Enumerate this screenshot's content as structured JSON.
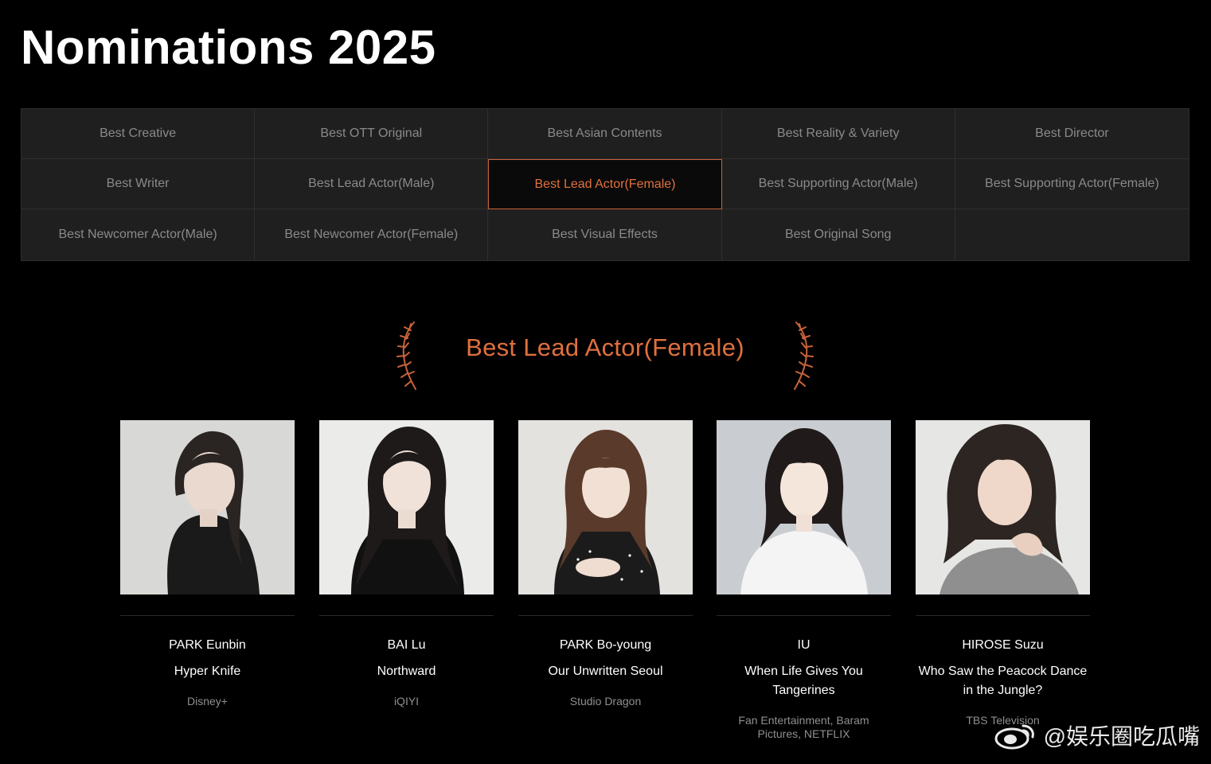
{
  "page": {
    "title": "Nominations 2025"
  },
  "categories": [
    {
      "label": "Best Creative"
    },
    {
      "label": "Best OTT Original"
    },
    {
      "label": "Best Asian Contents"
    },
    {
      "label": "Best Reality & Variety"
    },
    {
      "label": "Best Director"
    },
    {
      "label": "Best Writer"
    },
    {
      "label": "Best Lead Actor(Male)"
    },
    {
      "label": "Best Lead Actor(Female)"
    },
    {
      "label": "Best Supporting Actor(Male)"
    },
    {
      "label": "Best Supporting Actor(Female)"
    },
    {
      "label": "Best Newcomer Actor(Male)"
    },
    {
      "label": "Best Newcomer Actor(Female)"
    },
    {
      "label": "Best Visual Effects"
    },
    {
      "label": "Best Original Song"
    }
  ],
  "selected_category": "Best Lead Actor(Female)",
  "section": {
    "title": "Best Lead Actor(Female)"
  },
  "nominees": [
    {
      "name": "PARK Eunbin",
      "work": "Hyper Knife",
      "studio": "Disney+"
    },
    {
      "name": "BAI Lu",
      "work": "Northward",
      "studio": "iQIYI"
    },
    {
      "name": "PARK Bo-young",
      "work": "Our Unwritten Seoul",
      "studio": "Studio Dragon"
    },
    {
      "name": "IU",
      "work": "When Life Gives You Tangerines",
      "studio": "Fan Entertainment, Baram Pictures, NETFLIX"
    },
    {
      "name": "HIROSE Suzu",
      "work": "Who Saw the Peacock Dance in the Jungle?",
      "studio": "TBS Television"
    }
  ],
  "watermark": {
    "text": "@娱乐圈吃瓜嘴",
    "icon": "weibo-icon"
  },
  "colors": {
    "accent": "#e0703e",
    "background": "#000000",
    "grid_cell": "#1f1f1f",
    "muted_text": "#8a8a8a"
  }
}
